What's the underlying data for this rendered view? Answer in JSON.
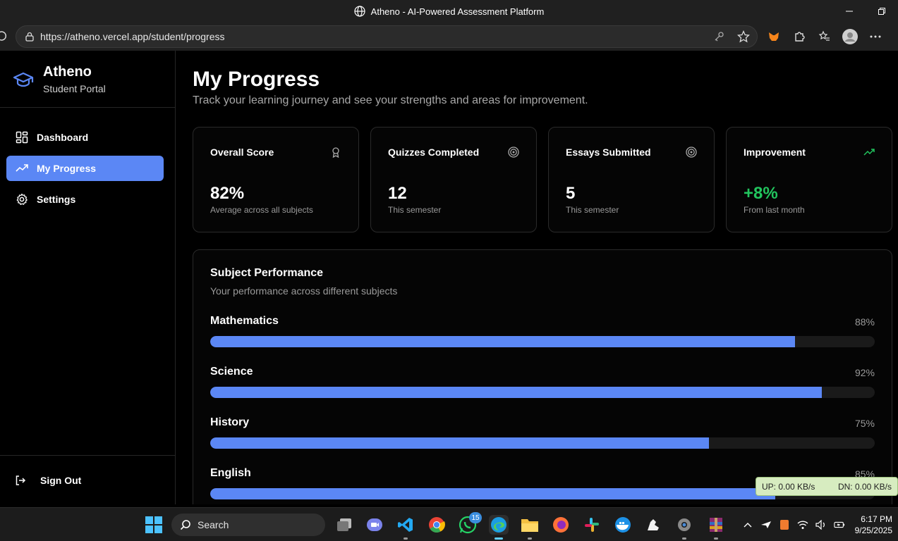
{
  "browser": {
    "window_title": "Atheno - AI-Powered Assessment Platform",
    "url": "https://atheno.vercel.app/student/progress"
  },
  "sidebar": {
    "brand_name": "Atheno",
    "brand_sub": "Student Portal",
    "items": [
      {
        "label": "Dashboard",
        "icon": "dashboard-grid-icon"
      },
      {
        "label": "My Progress",
        "icon": "trending-up-icon",
        "active": true
      },
      {
        "label": "Settings",
        "icon": "gear-icon"
      }
    ],
    "sign_out": "Sign Out"
  },
  "page": {
    "title": "My Progress",
    "subtitle": "Track your learning journey and see your strengths and areas for improvement."
  },
  "stats": [
    {
      "title": "Overall Score",
      "value": "82%",
      "sub": "Average across all subjects",
      "icon": "award-icon"
    },
    {
      "title": "Quizzes Completed",
      "value": "12",
      "sub": "This semester",
      "icon": "target-icon"
    },
    {
      "title": "Essays Submitted",
      "value": "5",
      "sub": "This semester",
      "icon": "target-icon"
    },
    {
      "title": "Improvement",
      "value": "+8%",
      "sub": "From last month",
      "icon": "trending-up-icon",
      "color": "#22c55e"
    }
  ],
  "performance": {
    "title": "Subject Performance",
    "subtitle": "Your performance across different subjects",
    "subjects": [
      {
        "name": "Mathematics",
        "pct_label": "88%",
        "value": 88
      },
      {
        "name": "Science",
        "pct_label": "92%",
        "value": 92
      },
      {
        "name": "History",
        "pct_label": "75%",
        "value": 75
      },
      {
        "name": "English",
        "pct_label": "85%",
        "value": 85
      }
    ]
  },
  "network_widget": {
    "up": "UP: 0.00 KB/s",
    "down": "DN: 0.00 KB/s"
  },
  "taskbar": {
    "search_label": "Search",
    "whatsapp_badge": "15",
    "time": "6:17 PM",
    "date": "9/25/2025"
  },
  "colors": {
    "accent": "#5b87f5",
    "positive": "#22c55e"
  }
}
